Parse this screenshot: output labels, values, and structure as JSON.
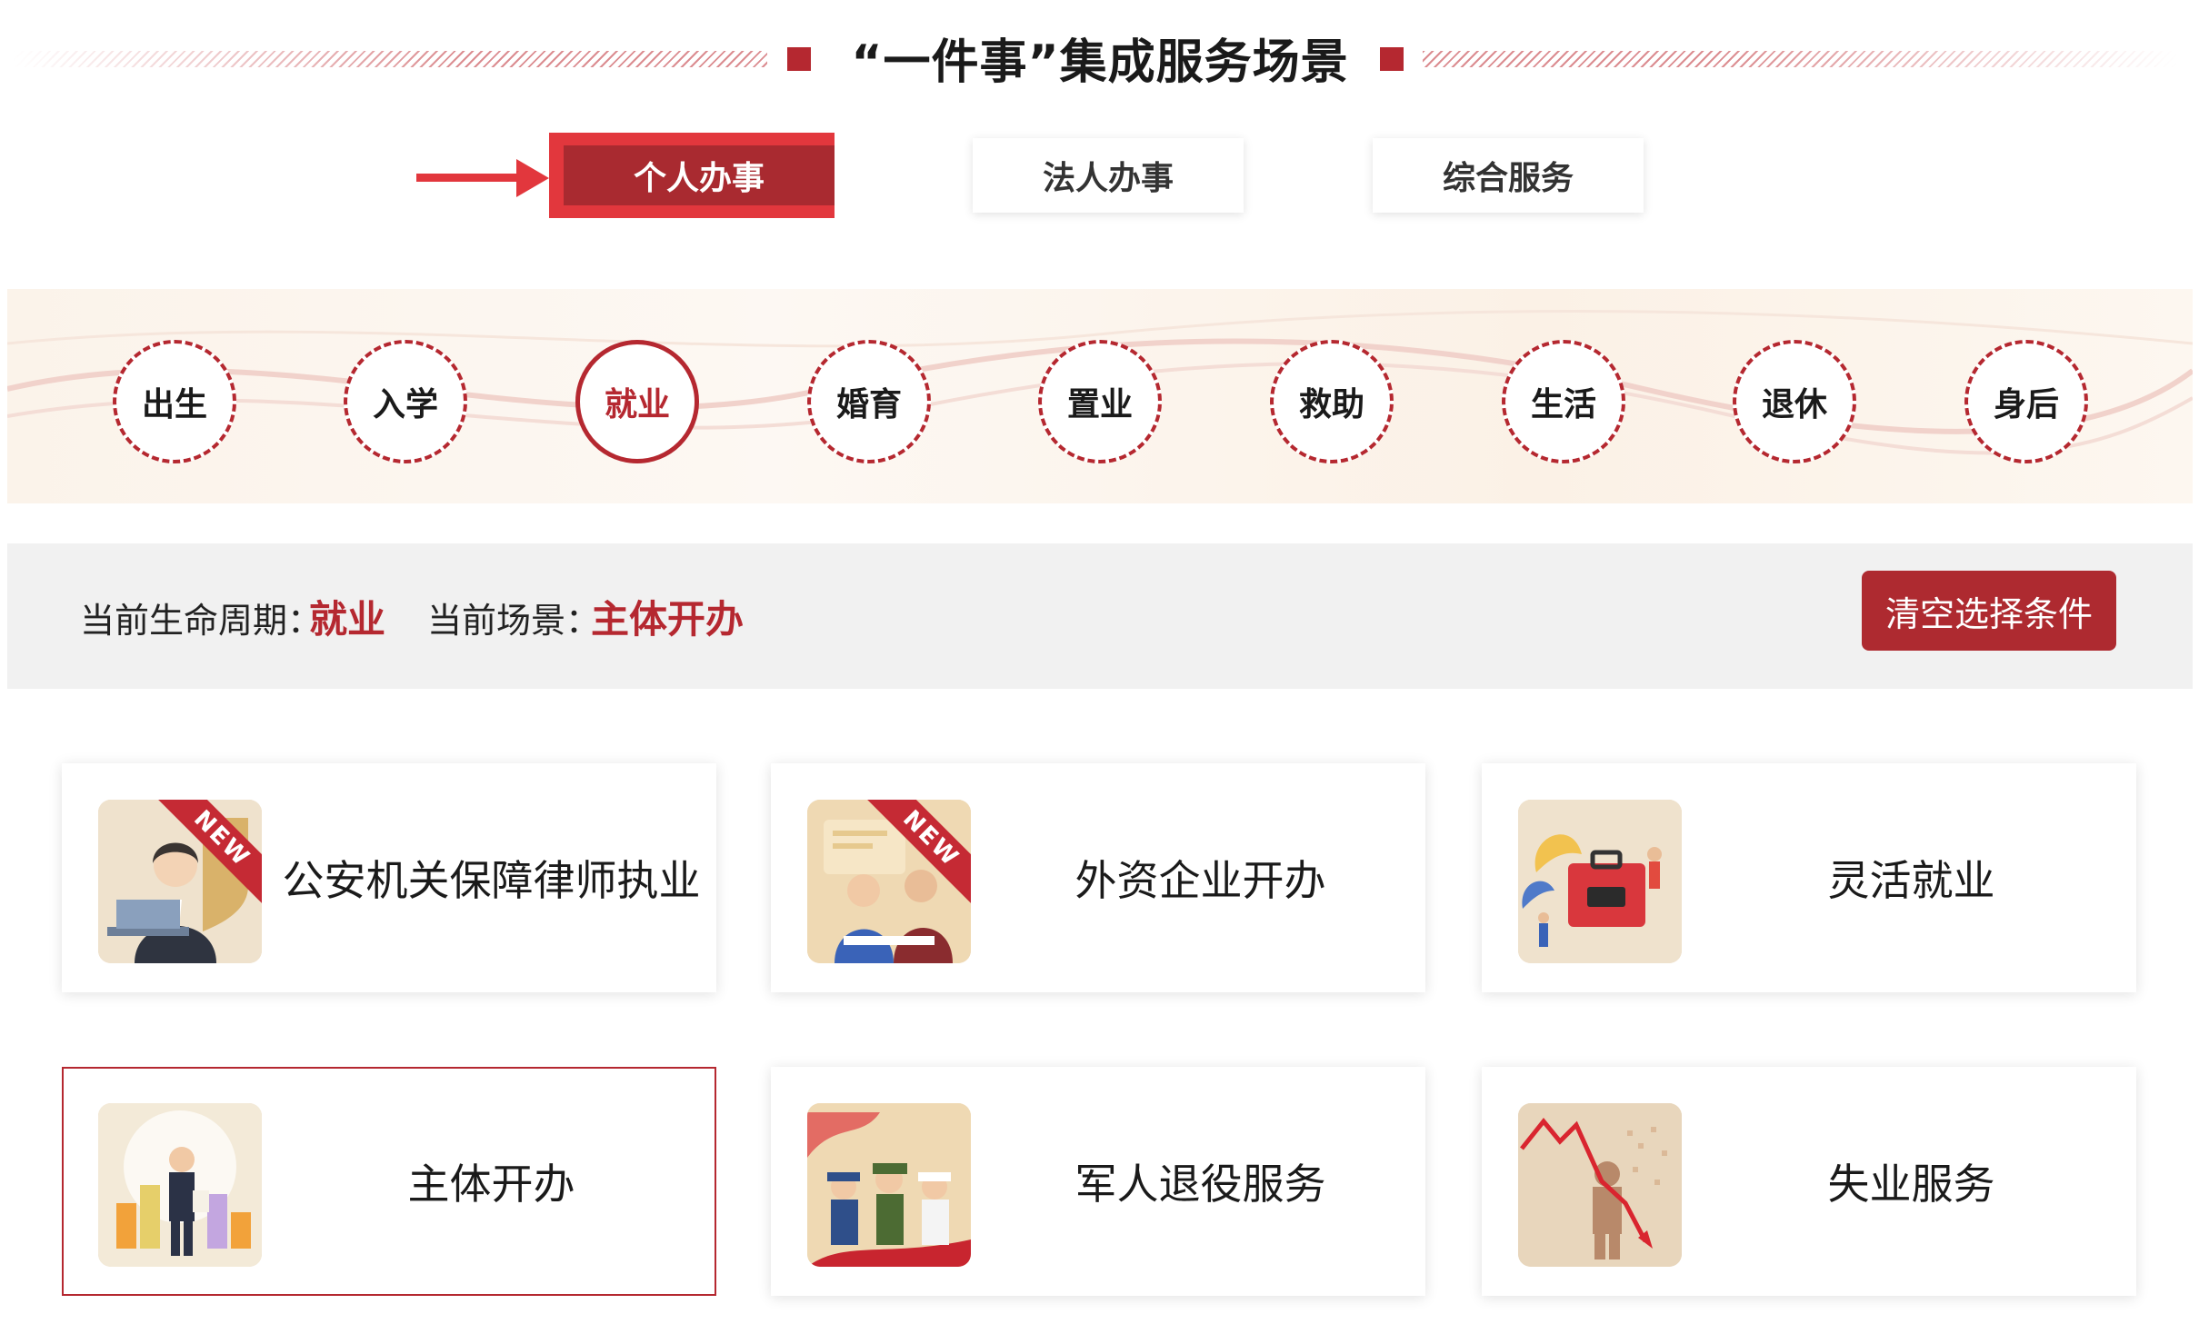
{
  "section": {
    "title": "“一件事”集成服务场景"
  },
  "tabs": [
    {
      "label": "个人办事",
      "active": true
    },
    {
      "label": "法人办事",
      "active": false
    },
    {
      "label": "综合服务",
      "active": false
    }
  ],
  "lifecycle": [
    {
      "label": "出生",
      "selected": false
    },
    {
      "label": "入学",
      "selected": false
    },
    {
      "label": "就业",
      "selected": true
    },
    {
      "label": "婚育",
      "selected": false
    },
    {
      "label": "置业",
      "selected": false
    },
    {
      "label": "救助",
      "selected": false
    },
    {
      "label": "生活",
      "selected": false
    },
    {
      "label": "退休",
      "selected": false
    },
    {
      "label": "身后",
      "selected": false
    }
  ],
  "filter": {
    "lifecycle_label": "当前生命周期：",
    "lifecycle_value": "就业",
    "scene_label": "当前场景：",
    "scene_value": "主体开办",
    "clear_button": "清空选择条件"
  },
  "new_badge": "NEW",
  "cards": [
    {
      "label": "公安机关保障律师执业",
      "icon": "lawyer-illustration-icon",
      "is_new": true,
      "selected": false
    },
    {
      "label": "外资企业开办",
      "icon": "business-meeting-illustration-icon",
      "is_new": true,
      "selected": false
    },
    {
      "label": "灵活就业",
      "icon": "briefcase-illustration-icon",
      "is_new": false,
      "selected": false
    },
    {
      "label": "主体开办",
      "icon": "business-owner-illustration-icon",
      "is_new": false,
      "selected": true
    },
    {
      "label": "军人退役服务",
      "icon": "soldiers-salute-illustration-icon",
      "is_new": false,
      "selected": false
    },
    {
      "label": "失业服务",
      "icon": "declining-chart-illustration-icon",
      "is_new": false,
      "selected": false
    }
  ],
  "colors": {
    "brand_red": "#b52830",
    "arrow_red": "#e2373d",
    "filter_bg": "#f1f1f1"
  }
}
